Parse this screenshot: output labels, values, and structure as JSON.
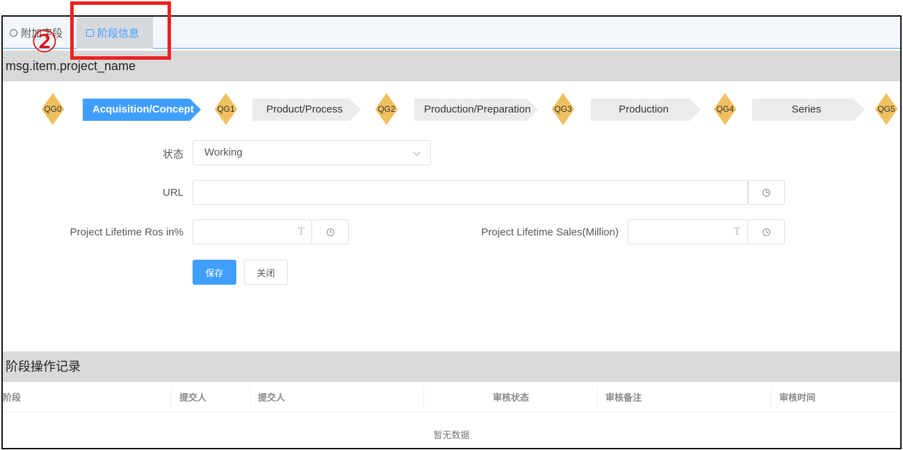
{
  "tabs": [
    {
      "label": "附加字段",
      "icon": "gear-icon"
    },
    {
      "label": "阶段信息",
      "icon": "form-icon"
    }
  ],
  "project_name": "msg.item.project_name",
  "stages": {
    "gates": [
      "QG0",
      "QG1",
      "QG2",
      "QG3",
      "QG4",
      "QG5"
    ],
    "steps": [
      {
        "label": "Acquisition/Concept",
        "active": true
      },
      {
        "label": "Product/Process",
        "active": false
      },
      {
        "label": "Production/Preparation",
        "active": false
      },
      {
        "label": "Production",
        "active": false
      },
      {
        "label": "Series",
        "active": false
      }
    ]
  },
  "form": {
    "status_label": "状态",
    "status_value": "Working",
    "url_label": "URL",
    "url_value": "",
    "ros_label": "Project Lifetime Ros in%",
    "ros_value": "",
    "sales_label": "Project Lifetime Sales(Million)",
    "sales_value": "",
    "save_label": "保存",
    "close_label": "关闭"
  },
  "log": {
    "title": "阶段操作记录",
    "columns": [
      "阶段",
      "提交人",
      "提交人",
      "审核状态",
      "审核备注",
      "审核时间"
    ],
    "empty_text": "暂无数据"
  },
  "annotation": {
    "number": "②",
    "color": "#f02020"
  },
  "colors": {
    "accent": "#409eff",
    "gate": "#f0c060"
  }
}
